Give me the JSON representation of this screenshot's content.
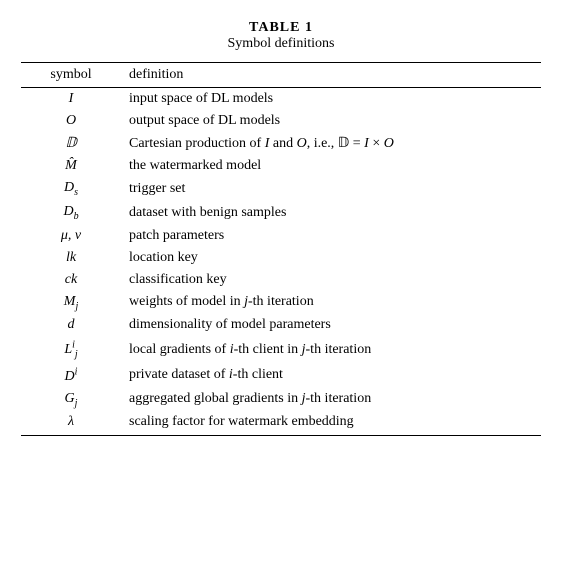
{
  "title": {
    "line1": "TABLE 1",
    "line2": "Symbol definitions"
  },
  "table": {
    "headers": [
      "symbol",
      "definition"
    ],
    "rows": [
      {
        "symbol_html": "<i>I</i>",
        "definition_html": "input space of DL models"
      },
      {
        "symbol_html": "<i>O</i>",
        "definition_html": "output space of DL models"
      },
      {
        "symbol_html": "&#x1D53B;",
        "definition_html": "Cartesian production of <i>I</i> and <i>O</i>, i.e., &#x1D53B; = <i>I</i> &times; <i>O</i>"
      },
      {
        "symbol_html": "<i>M&#x0302;</i>",
        "definition_html": "the watermarked model"
      },
      {
        "symbol_html": "<i>D<sub>s</sub></i>",
        "definition_html": "trigger set"
      },
      {
        "symbol_html": "<i>D<sub>b</sub></i>",
        "definition_html": "dataset with benign samples"
      },
      {
        "symbol_html": "<i>&mu;</i>, <i>&nu;</i>",
        "definition_html": "patch parameters"
      },
      {
        "symbol_html": "<i>lk</i>",
        "definition_html": "location key"
      },
      {
        "symbol_html": "<i>ck</i>",
        "definition_html": "classification key"
      },
      {
        "symbol_html": "<i>M<sub>j</sub></i>",
        "definition_html": "weights of model in <i>j</i>-th iteration"
      },
      {
        "symbol_html": "<i>d</i>",
        "definition_html": "dimensionality of model parameters"
      },
      {
        "symbol_html": "<i>L<sup>i</sup><sub>j</sub></i>",
        "definition_html": "local gradients of <i>i</i>-th client in <i>j</i>-th iteration"
      },
      {
        "symbol_html": "<i>D<sup>i</sup></i>",
        "definition_html": "private dataset of <i>i</i>-th client"
      },
      {
        "symbol_html": "<i>G<sub>j</sub></i>",
        "definition_html": "aggregated global gradients in <i>j</i>-th iteration"
      },
      {
        "symbol_html": "<i>&lambda;</i>",
        "definition_html": "scaling factor for watermark embedding"
      }
    ]
  }
}
